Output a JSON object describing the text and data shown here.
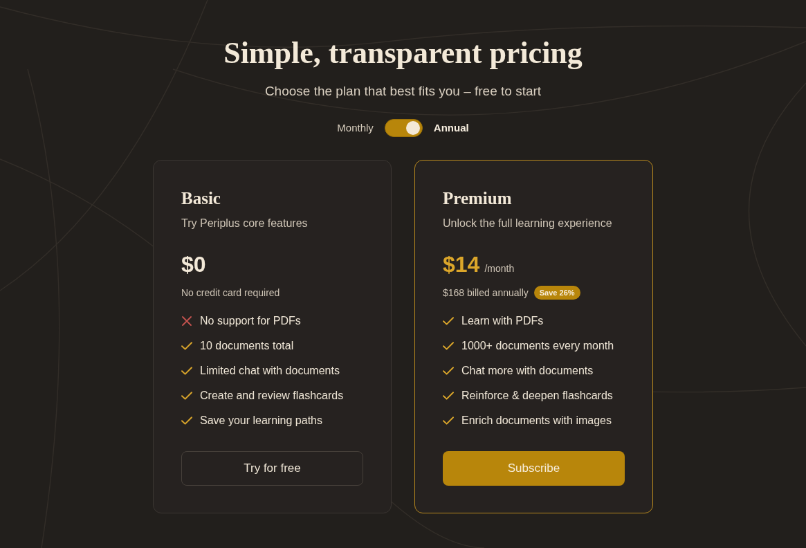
{
  "heading": {
    "title": "Simple, transparent pricing",
    "subtitle": "Choose the plan that best fits you – free to start"
  },
  "billing_toggle": {
    "on": true,
    "options": [
      {
        "label": "Monthly",
        "selected": false
      },
      {
        "label": "Annual",
        "selected": true
      }
    ]
  },
  "plans": [
    {
      "name": "Basic",
      "tagline": "Try Periplus core features",
      "highlighted": false,
      "price": "$0",
      "note": "No credit card required",
      "features": [
        {
          "text": "No support for PDFs",
          "included": false
        },
        {
          "text": "10 documents total",
          "included": true
        },
        {
          "text": "Limited chat with documents",
          "included": true
        },
        {
          "text": "Create and review flashcards",
          "included": true
        },
        {
          "text": "Save your learning paths",
          "included": true
        }
      ],
      "button": {
        "label": "Try for free",
        "kind": "outline"
      }
    },
    {
      "name": "Premium",
      "tagline": "Unlock the full learning experience",
      "highlighted": true,
      "price": "$14",
      "period": "/month",
      "note": "$168 billed annually",
      "badge": "Save 26%",
      "features": [
        {
          "text": "Learn with PDFs",
          "included": true
        },
        {
          "text": "1000+ documents every month",
          "included": true
        },
        {
          "text": "Chat more with documents",
          "included": true
        },
        {
          "text": "Reinforce & deepen flashcards",
          "included": true
        },
        {
          "text": "Enrich documents with images",
          "included": true
        }
      ],
      "button": {
        "label": "Subscribe",
        "kind": "filled"
      }
    }
  ]
}
